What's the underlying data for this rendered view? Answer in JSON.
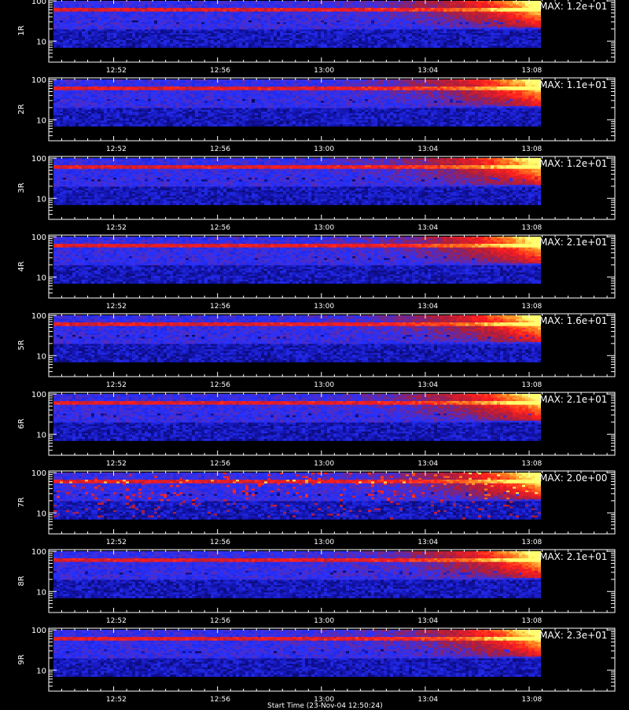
{
  "chart_data": {
    "type": "heatmap",
    "colorscale": [
      "#000000",
      "#1010a0",
      "#2030ff",
      "#c02030",
      "#ff2020",
      "#ff8020",
      "#ffff60"
    ],
    "x_ticks": [
      "12:52",
      "12:56",
      "13:00",
      "13:04",
      "13:08"
    ],
    "x_tick_minutes": [
      12.6,
      16.6,
      20.6,
      24.6,
      28.6
    ],
    "x_range_minutes": [
      10.0,
      31.8
    ],
    "data_end_minutes": 28.9,
    "y_ticks": [
      "100",
      "10"
    ],
    "y_range": [
      3,
      110
    ],
    "y_scale": "log",
    "panels": [
      {
        "label": "1R",
        "max_text": "MAX: 1.2e+01",
        "max": 12
      },
      {
        "label": "2R",
        "max_text": "MAX: 1.1e+01",
        "max": 11
      },
      {
        "label": "3R",
        "max_text": "MAX: 1.2e+01",
        "max": 12
      },
      {
        "label": "4R",
        "max_text": "MAX: 2.1e+01",
        "max": 21
      },
      {
        "label": "5R",
        "max_text": "MAX: 1.6e+01",
        "max": 16
      },
      {
        "label": "6R",
        "max_text": "MAX: 2.1e+01",
        "max": 21
      },
      {
        "label": "7R",
        "max_text": "MAX: 2.0e+00",
        "max": 2
      },
      {
        "label": "8R",
        "max_text": "MAX: 2.1e+01",
        "max": 21
      },
      {
        "label": "9R",
        "max_text": "MAX: 2.3e+01",
        "max": 23
      }
    ]
  },
  "footer_text": "Start Time (23-Nov-04 12:50:24)"
}
